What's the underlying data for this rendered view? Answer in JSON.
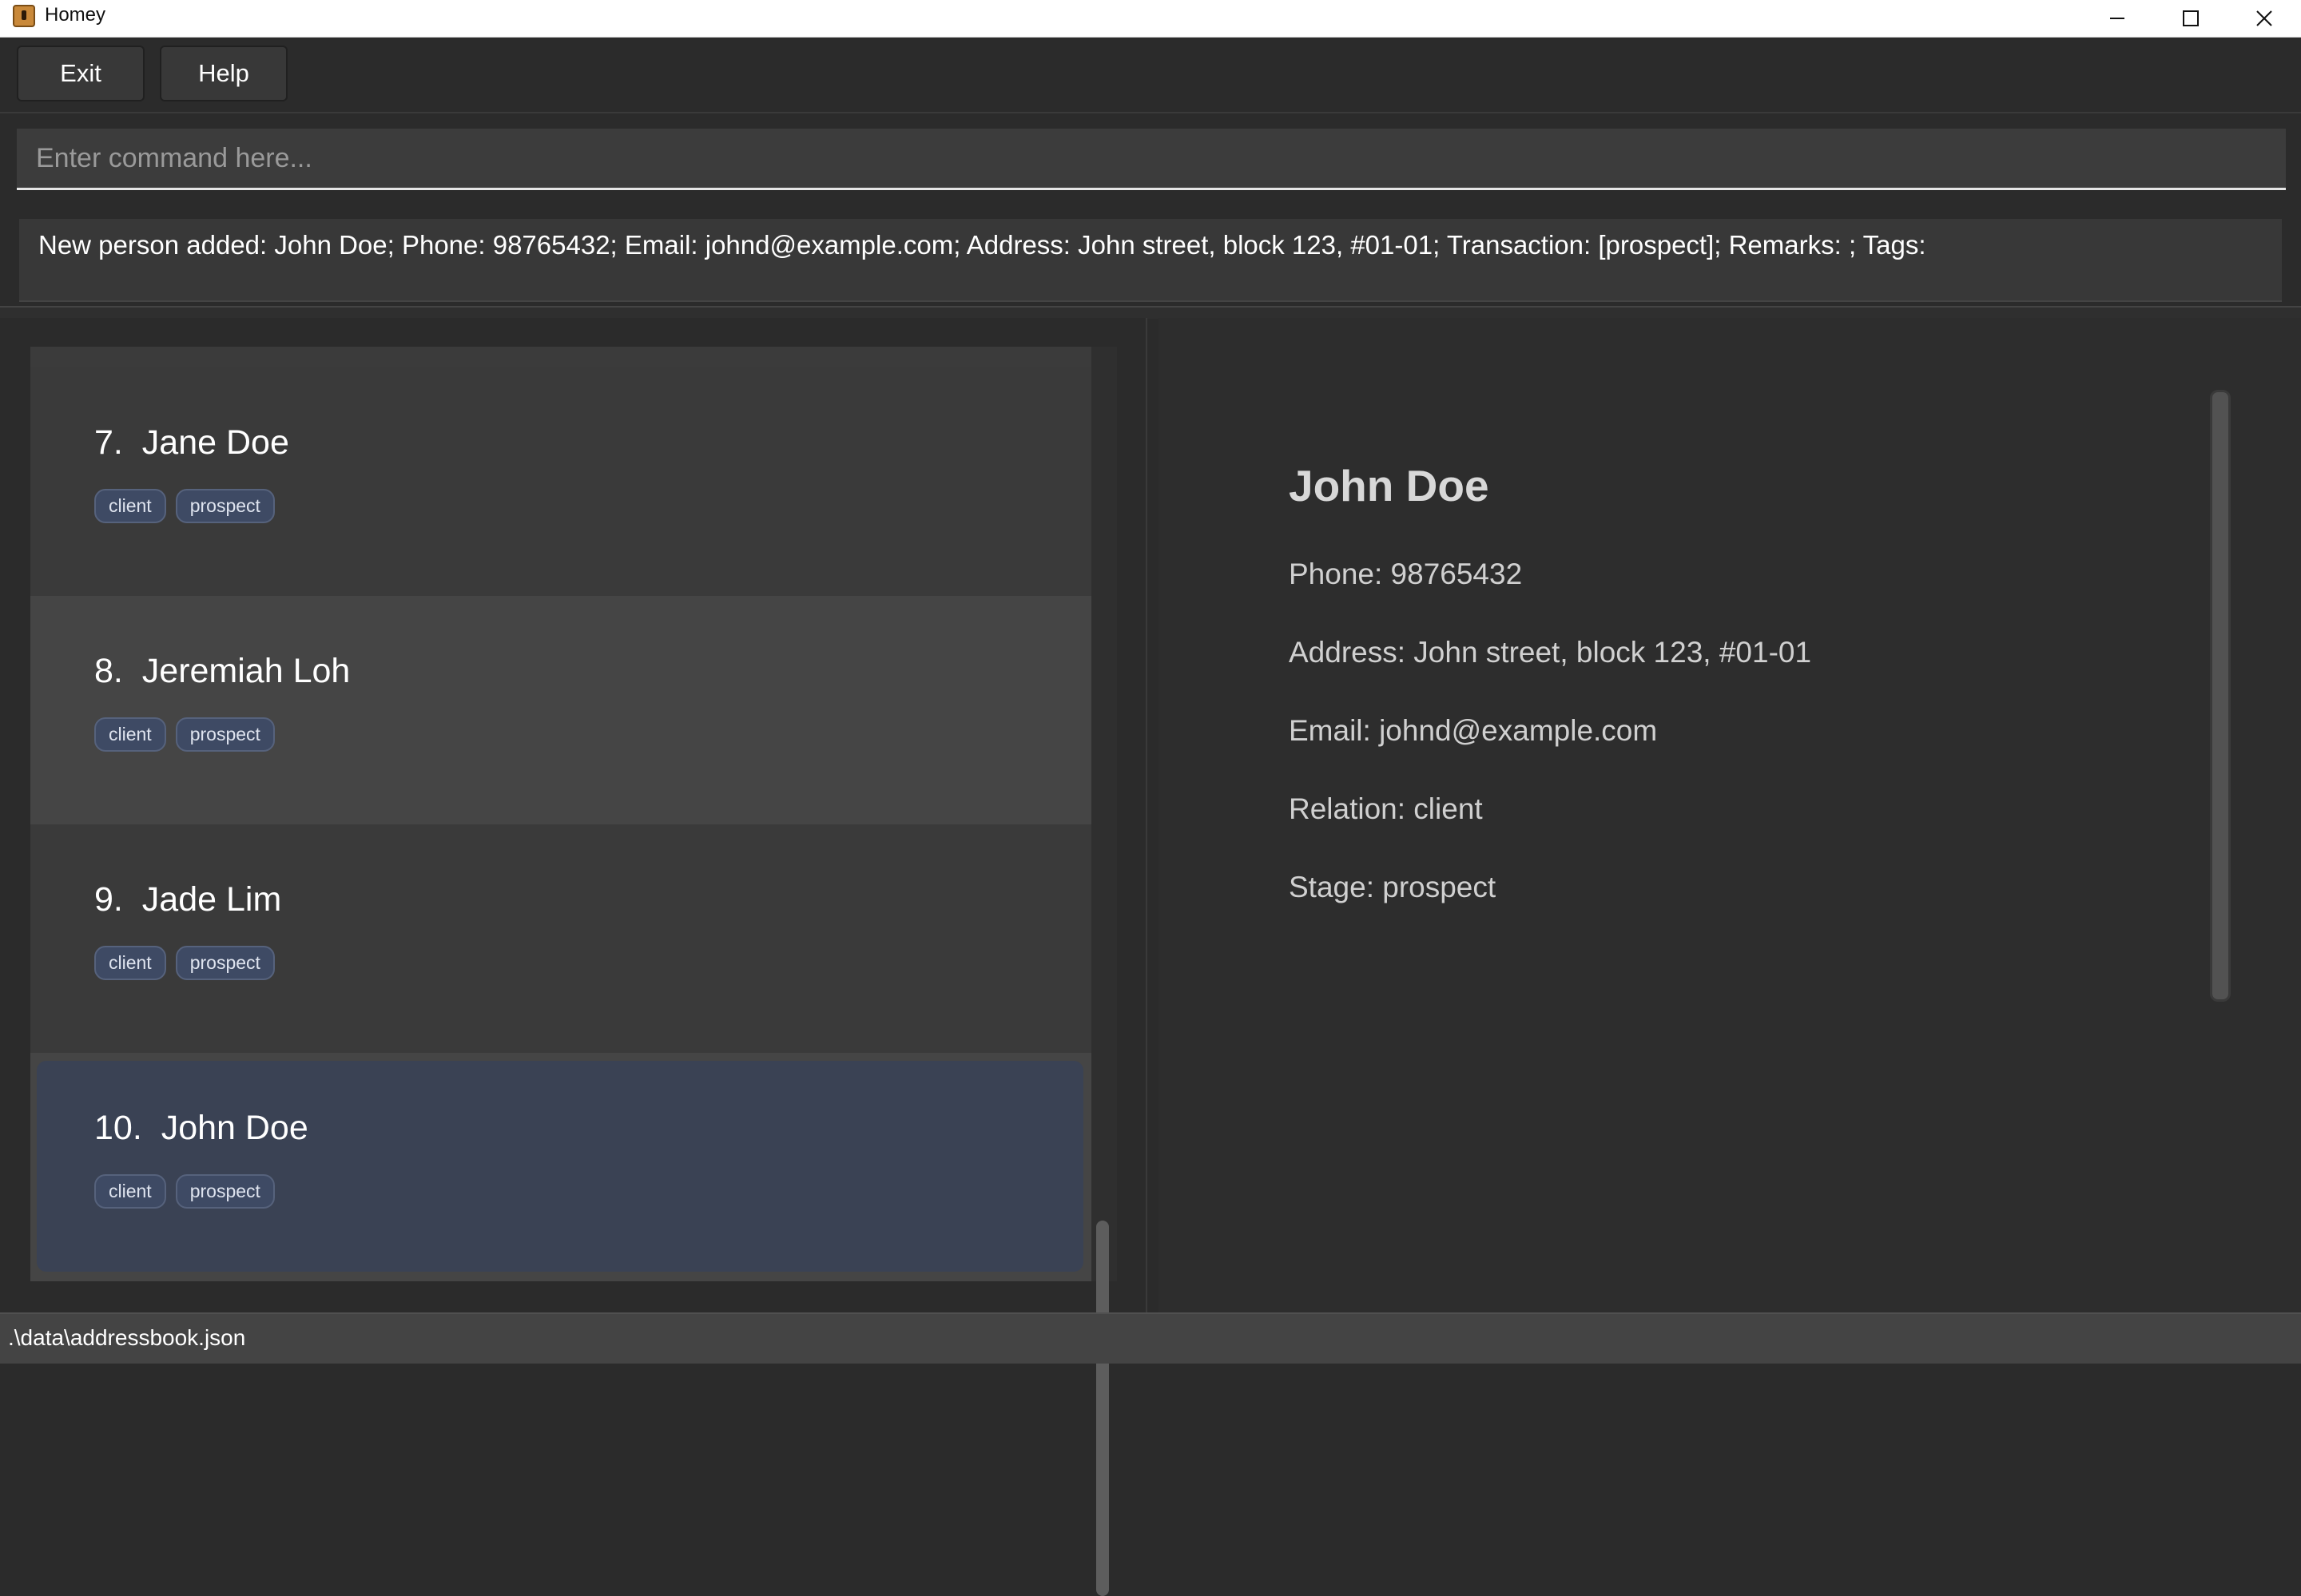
{
  "window": {
    "title": "Homey",
    "icons": {
      "app": "app-icon",
      "minimize": "minimize-icon",
      "maximize": "maximize-icon",
      "close": "close-icon"
    }
  },
  "menu": {
    "exit_label": "Exit",
    "help_label": "Help"
  },
  "command": {
    "value": "",
    "placeholder": "Enter command here..."
  },
  "result": {
    "text": "New person added: John Doe; Phone: 98765432; Email: johnd@example.com; Address: John street, block 123, #01-01; Transaction: [prospect]; Remarks: ; Tags:"
  },
  "person_list": {
    "items": [
      {
        "index": "7.",
        "name": "Jane Doe",
        "tags": [
          "client",
          "prospect"
        ]
      },
      {
        "index": "8.",
        "name": "Jeremiah Loh",
        "tags": [
          "client",
          "prospect"
        ]
      },
      {
        "index": "9.",
        "name": "Jade Lim",
        "tags": [
          "client",
          "prospect"
        ]
      },
      {
        "index": "10.",
        "name": "John Doe",
        "tags": [
          "client",
          "prospect"
        ]
      }
    ]
  },
  "detail": {
    "name": "John Doe",
    "phone": "Phone: 98765432",
    "address": "Address: John street, block 123, #01-01",
    "email": "Email: johnd@example.com",
    "relation": "Relation: client",
    "stage": "Stage: prospect"
  },
  "status": {
    "path": ".\\data\\addressbook.json"
  },
  "colors": {
    "background": "#2b2b2b",
    "selected_card": "#3a4254",
    "tag_bg": "#3e4a64",
    "card_even": "#3a3a3a",
    "card_odd": "#454545"
  }
}
